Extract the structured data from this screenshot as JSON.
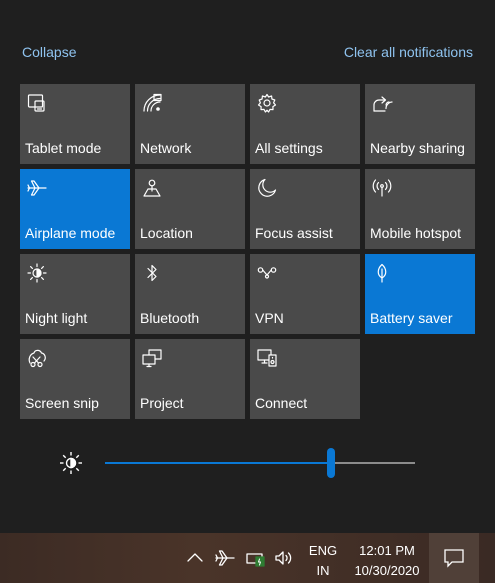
{
  "header": {
    "collapse_label": "Collapse",
    "clear_label": "Clear all notifications"
  },
  "tiles": [
    {
      "label": "Tablet mode",
      "icon": "tablet-mode-icon",
      "active": false
    },
    {
      "label": "Network",
      "icon": "network-icon",
      "active": false
    },
    {
      "label": "All settings",
      "icon": "gear-icon",
      "active": false
    },
    {
      "label": "Nearby sharing",
      "icon": "nearby-sharing-icon",
      "active": false
    },
    {
      "label": "Airplane mode",
      "icon": "airplane-icon",
      "active": true
    },
    {
      "label": "Location",
      "icon": "location-icon",
      "active": false
    },
    {
      "label": "Focus assist",
      "icon": "moon-icon",
      "active": false
    },
    {
      "label": "Mobile hotspot",
      "icon": "hotspot-icon",
      "active": false
    },
    {
      "label": "Night light",
      "icon": "night-light-icon",
      "active": false
    },
    {
      "label": "Bluetooth",
      "icon": "bluetooth-icon",
      "active": false
    },
    {
      "label": "VPN",
      "icon": "vpn-icon",
      "active": false
    },
    {
      "label": "Battery saver",
      "icon": "leaf-icon",
      "active": true
    },
    {
      "label": "Screen snip",
      "icon": "screen-snip-icon",
      "active": false
    },
    {
      "label": "Project",
      "icon": "project-icon",
      "active": false
    },
    {
      "label": "Connect",
      "icon": "connect-icon",
      "active": false
    }
  ],
  "brightness": {
    "icon": "brightness-icon",
    "level": 73
  },
  "taskbar": {
    "language_line1": "ENG",
    "language_line2": "IN",
    "time": "12:01 PM",
    "date": "10/30/2020",
    "tray_icons": [
      "chevron-up-icon",
      "airplane-icon",
      "battery-icon",
      "volume-icon"
    ]
  },
  "colors": {
    "accent": "#0a78d4",
    "tile": "#4a4a4a",
    "panel": "#1f1f1f",
    "link": "#8fc3ef"
  }
}
